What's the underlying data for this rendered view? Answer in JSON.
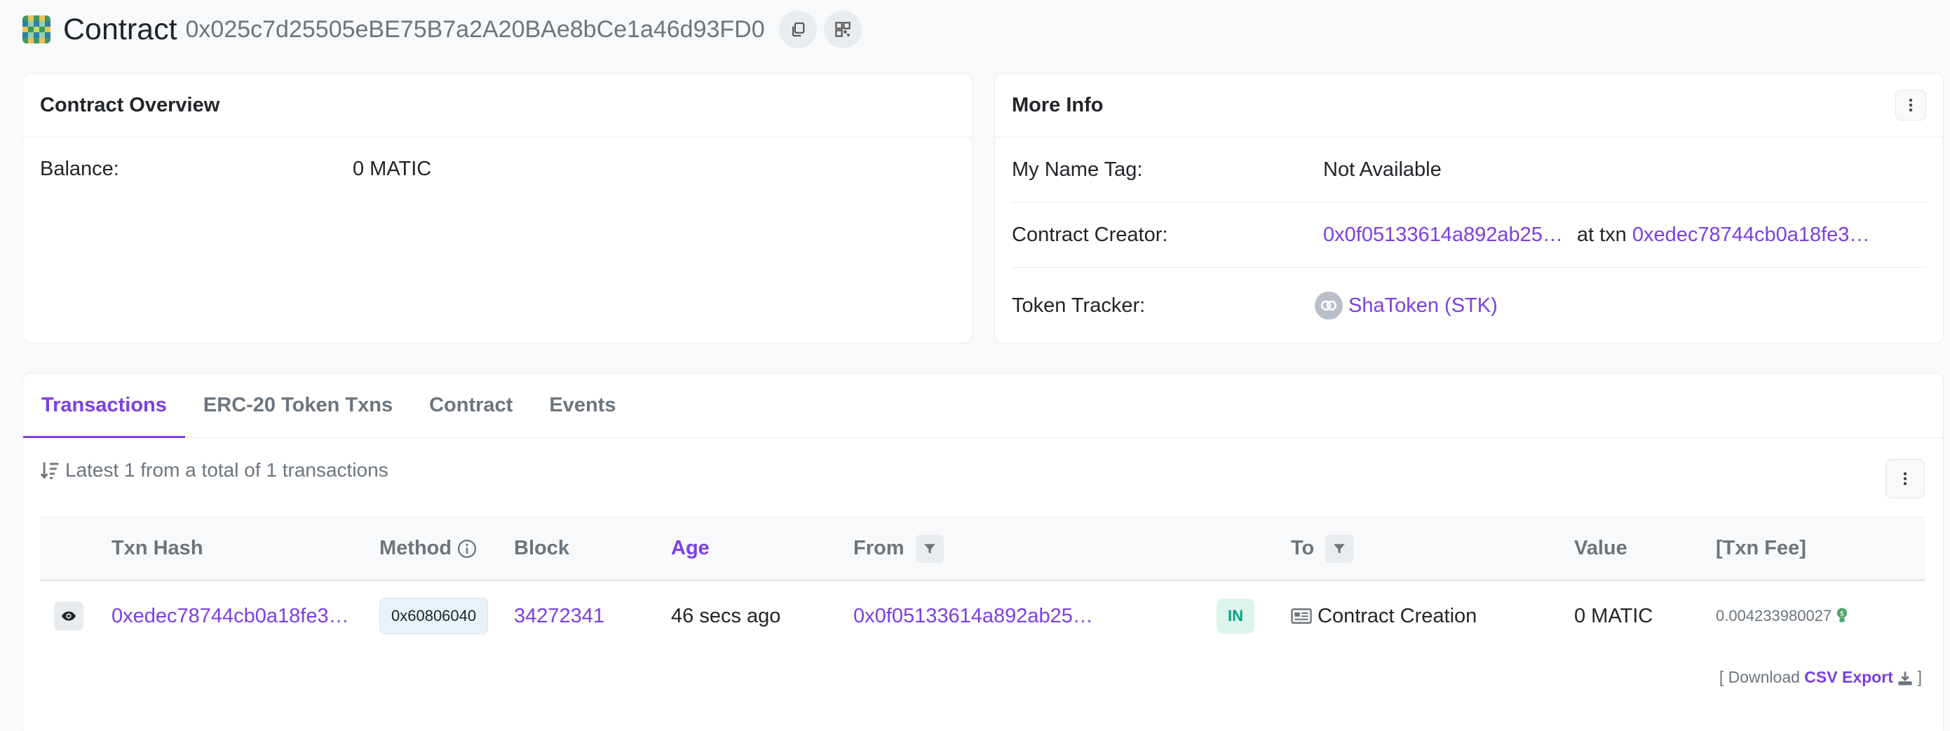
{
  "header": {
    "title": "Contract",
    "address": "0x025c7d25505eBE75B7a2A20BAe8bCe1a46d93FD0",
    "copy_icon": "copy-icon",
    "qr_icon": "qr-code-icon"
  },
  "overview": {
    "title": "Contract Overview",
    "balance_label": "Balance:",
    "balance_value": "0 MATIC"
  },
  "more_info": {
    "title": "More Info",
    "name_tag_label": "My Name Tag:",
    "name_tag_value": "Not Available",
    "creator_label": "Contract Creator:",
    "creator_address": "0x0f05133614a892ab25…",
    "at_txn": "at txn",
    "creator_txn": "0xedec78744cb0a18fe3…",
    "token_label": "Token Tracker:",
    "token_value": "ShaToken (STK)"
  },
  "tabs": [
    "Transactions",
    "ERC-20 Token Txns",
    "Contract",
    "Events"
  ],
  "transactions": {
    "summary": "Latest 1 from a total of 1 transactions",
    "columns": {
      "txn_hash": "Txn Hash",
      "method": "Method",
      "block": "Block",
      "age": "Age",
      "from": "From",
      "to": "To",
      "value": "Value",
      "fee": "[Txn Fee]"
    },
    "rows": [
      {
        "txn_hash": "0xedec78744cb0a18fe3…",
        "method": "0x60806040",
        "block": "34272341",
        "age": "46 secs ago",
        "from": "0x0f05133614a892ab25…",
        "direction": "IN",
        "to": "Contract Creation",
        "value": "0 MATIC",
        "fee": "0.004233980027"
      }
    ],
    "download_prefix": "[ Download",
    "csv_label": "CSV Export",
    "download_suffix": "]"
  },
  "colors": {
    "accent": "#7b3fe4",
    "in_badge": "#00a186",
    "background": "#f8f9fa"
  }
}
